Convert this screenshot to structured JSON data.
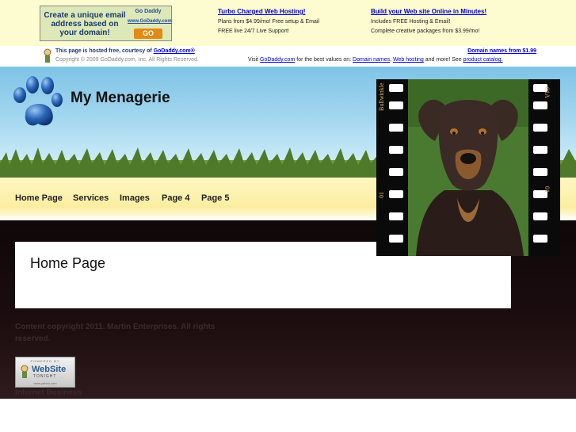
{
  "ad": {
    "box_text": "Create a unique email address based on your domain!",
    "box_logo": "Go Daddy",
    "box_url": "www.GoDaddy.com",
    "box_go": "GO",
    "col1": {
      "title": "Turbo Charged Web Hosting!",
      "line1": "Plans from $4.99/mo! Free setup & Email",
      "line2": "FREE live 24/7 Live Support!"
    },
    "col2": {
      "title": "Build your Web site Online in Minutes!",
      "line1": "Includes FREE Hosting & Email!",
      "line2": "Complete creative packages from $3.99/mo!"
    },
    "hosted_prefix": "This page is hosted free, courtesy of ",
    "hosted_link": "GoDaddy.com®",
    "copyright": "Copyright © 2009 GoDaddy.com, Inc. All Rights Reserved.",
    "domain_names": "Domain names from $1.99",
    "visit_prefix": "Visit ",
    "visit_link1": "GoDaddy.com",
    "visit_mid": " for the best values on: ",
    "visit_link2": "Domain names",
    "visit_comma": ", ",
    "visit_link3": "Web hosting",
    "visit_mid2": " and more! See ",
    "visit_link4": "product catalog."
  },
  "site": {
    "title": "My Menagerie"
  },
  "nav": {
    "items": [
      "Home Page",
      "Services",
      "Images",
      "Page 4",
      "Page 5"
    ]
  },
  "content": {
    "heading": "Home Page"
  },
  "footer": {
    "copyright": "Content copyright 2011. Martin Enterprises. All rights reserved.",
    "badge_powered": "POWERED BY",
    "badge_website": "WebSite",
    "badge_tonight": "TONIGHT",
    "badge_url": "www.yahoo.com",
    "internet_business": "Internet Business"
  },
  "film": {
    "label_left": "Bullwinkle",
    "label_right": "01A",
    "frame_left": "01",
    "frame_right": "01"
  },
  "colors": {
    "sky": "#7fc3e6",
    "nav_bg": "#fbeea0",
    "dark_bg": "#1d0e10",
    "link": "#0000cc"
  }
}
